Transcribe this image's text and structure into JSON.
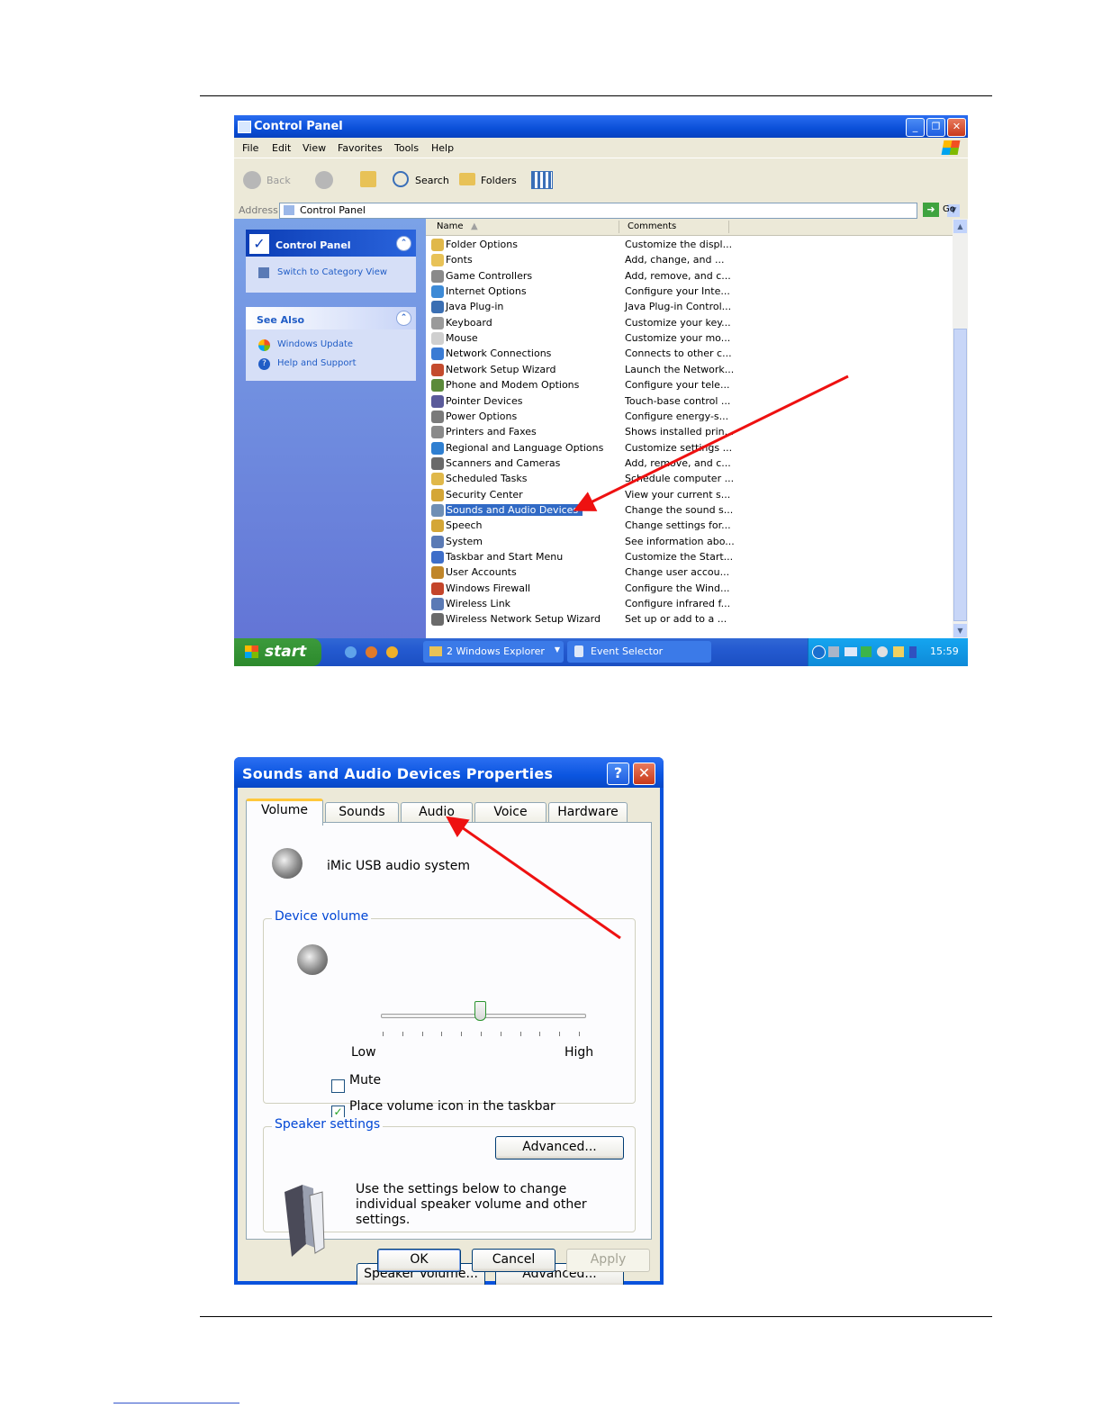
{
  "control_panel": {
    "title": "Control Panel",
    "menu": [
      "File",
      "Edit",
      "View",
      "Favorites",
      "Tools",
      "Help"
    ],
    "toolbar": {
      "back": "Back",
      "search": "Search",
      "folders": "Folders"
    },
    "address": {
      "label": "Address",
      "value": "Control Panel",
      "go": "Go"
    },
    "left_panel": {
      "title": "Control Panel",
      "switch_view": "Switch to Category View",
      "see_also_title": "See Also",
      "links": [
        "Windows Update",
        "Help and Support"
      ]
    },
    "columns": [
      "Name",
      "Comments"
    ],
    "items": [
      {
        "name": "Folder Options",
        "comment": "Customize the displ...",
        "color": "#e0b84a"
      },
      {
        "name": "Fonts",
        "comment": "Add, change, and ...",
        "color": "#e8c257"
      },
      {
        "name": "Game Controllers",
        "comment": "Add, remove, and c...",
        "color": "#8a8a8a"
      },
      {
        "name": "Internet Options",
        "comment": "Configure your Inte...",
        "color": "#3d8ad6"
      },
      {
        "name": "Java Plug-in",
        "comment": "Java Plug-in Control...",
        "color": "#3b6fb3"
      },
      {
        "name": "Keyboard",
        "comment": "Customize your key...",
        "color": "#9a9a9a"
      },
      {
        "name": "Mouse",
        "comment": "Customize your mo...",
        "color": "#cfcfcf"
      },
      {
        "name": "Network Connections",
        "comment": "Connects to other c...",
        "color": "#3a7bd4"
      },
      {
        "name": "Network Setup Wizard",
        "comment": "Launch the Network...",
        "color": "#c44b2e"
      },
      {
        "name": "Phone and Modem Options",
        "comment": "Configure your tele...",
        "color": "#5b8a3a"
      },
      {
        "name": "Pointer Devices",
        "comment": "Touch-base control ...",
        "color": "#5a5a9a"
      },
      {
        "name": "Power Options",
        "comment": "Configure energy-s...",
        "color": "#7a7a7a"
      },
      {
        "name": "Printers and Faxes",
        "comment": "Shows installed prin...",
        "color": "#8a8a8a"
      },
      {
        "name": "Regional and Language Options",
        "comment": "Customize settings ...",
        "color": "#2f7fd1"
      },
      {
        "name": "Scanners and Cameras",
        "comment": "Add, remove, and c...",
        "color": "#6a6a6a"
      },
      {
        "name": "Scheduled Tasks",
        "comment": "Schedule computer ...",
        "color": "#e0b84a"
      },
      {
        "name": "Security Center",
        "comment": "View your current s...",
        "color": "#d4a637"
      },
      {
        "name": "Sounds and Audio Devices",
        "comment": "Change the sound s...",
        "color": "#6f8fb5",
        "selected": true
      },
      {
        "name": "Speech",
        "comment": "Change settings for...",
        "color": "#d4a637"
      },
      {
        "name": "System",
        "comment": "See information abo...",
        "color": "#5a7ab5"
      },
      {
        "name": "Taskbar and Start Menu",
        "comment": "Customize the Start...",
        "color": "#3e6ec9"
      },
      {
        "name": "User Accounts",
        "comment": "Change user accou...",
        "color": "#c0862a"
      },
      {
        "name": "Windows Firewall",
        "comment": "Configure the Wind...",
        "color": "#c4452a"
      },
      {
        "name": "Wireless Link",
        "comment": "Configure infrared f...",
        "color": "#5a7ab5"
      },
      {
        "name": "Wireless Network Setup Wizard",
        "comment": "Set up or add to a ...",
        "color": "#6a6a6a"
      }
    ],
    "taskbar": {
      "start": "start",
      "tasks": [
        "2 Windows Explorer",
        "Event Selector"
      ],
      "clock": "15:59"
    }
  },
  "sound_dialog": {
    "title": "Sounds and Audio Devices Properties",
    "tabs": [
      "Volume",
      "Sounds",
      "Audio",
      "Voice",
      "Hardware"
    ],
    "active_tab": "Volume",
    "device": "iMic USB audio system",
    "device_volume": {
      "label": "Device volume",
      "low": "Low",
      "high": "High",
      "level": 0.5,
      "mute_label": "Mute",
      "mute_checked": false,
      "taskbar_icon_label": "Place volume icon in the taskbar",
      "taskbar_icon_checked": true,
      "advanced": "Advanced..."
    },
    "speaker_settings": {
      "label": "Speaker settings",
      "text": "Use the settings below to change individual speaker volume and other settings.",
      "speaker_volume": "Speaker Volume...",
      "advanced": "Advanced..."
    },
    "buttons": {
      "ok": "OK",
      "cancel": "Cancel",
      "apply": "Apply"
    }
  },
  "colors": {
    "xp_blue": "#0a52dc",
    "highlight": "#316ac5",
    "annotation_arrow": "#ee1111"
  }
}
